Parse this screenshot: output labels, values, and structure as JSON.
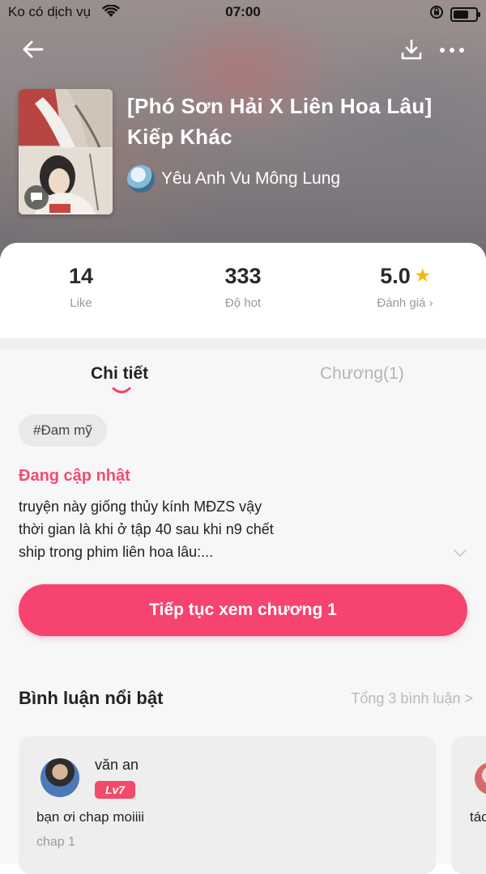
{
  "status_bar": {
    "carrier": "Ko có dịch vụ",
    "time": "07:00"
  },
  "book": {
    "title": "[Phó Sơn Hải X Liên Hoa Lâu] Kiếp Khác",
    "author": "Yêu Anh Vu Mông Lung"
  },
  "stats": [
    {
      "value": "14",
      "label": "Like"
    },
    {
      "value": "333",
      "label": "Độ hot"
    },
    {
      "value": "5.0",
      "label": "Đánh giá ›"
    }
  ],
  "tabs": [
    {
      "label": "Chi tiết",
      "active": true
    },
    {
      "label": "Chương(1)",
      "active": false
    }
  ],
  "tag": "#Đam mỹ",
  "update_status": "Đang cập nhật",
  "description_lines": [
    "truyện này giống thủy kính MĐZS vậy",
    "thời gian là khi ở tập 40 sau khi n9 chết",
    "ship trong phim liên hoa lâu:..."
  ],
  "cta_label": "Tiếp tục xem chương 1",
  "comments_section": {
    "title": "Bình luận nổi bật",
    "total": "Tổng 3 bình luận >",
    "comments": [
      {
        "user": "văn an",
        "level": "Lv7",
        "text": "bạn ơi chap moiiii",
        "chapter": "chap 1"
      },
      {
        "text": "tác"
      }
    ]
  },
  "colors": {
    "accent": "#f7436f",
    "status_pink": "#ef4d73",
    "star": "#f5b800"
  }
}
